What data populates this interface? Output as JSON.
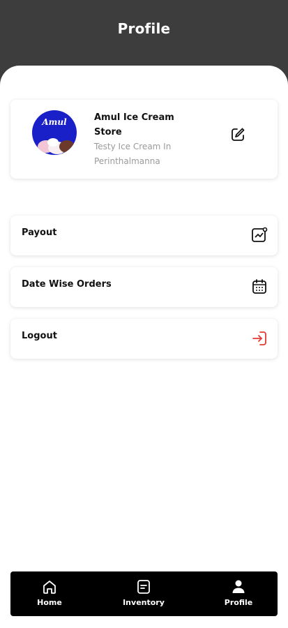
{
  "header": {
    "title": "Profile"
  },
  "store": {
    "avatar_text": "Amul",
    "name": "Amul Ice Cream Store",
    "description": "Testy Ice Cream In Perinthalmanna"
  },
  "menu": [
    {
      "label": "Payout",
      "icon": "payout-chart-icon"
    },
    {
      "label": "Date Wise Orders",
      "icon": "calendar-icon"
    },
    {
      "label": "Logout",
      "icon": "logout-icon",
      "accent": "#e53935"
    }
  ],
  "tabs": [
    {
      "label": "Home",
      "icon": "home-icon"
    },
    {
      "label": "Inventory",
      "icon": "inventory-icon"
    },
    {
      "label": "Profile",
      "icon": "user-icon"
    }
  ],
  "colors": {
    "header_bg": "#3d3d3d",
    "tabbar_bg": "#000000",
    "logout_accent": "#e53935",
    "secondary_text": "#9a9a9a"
  }
}
